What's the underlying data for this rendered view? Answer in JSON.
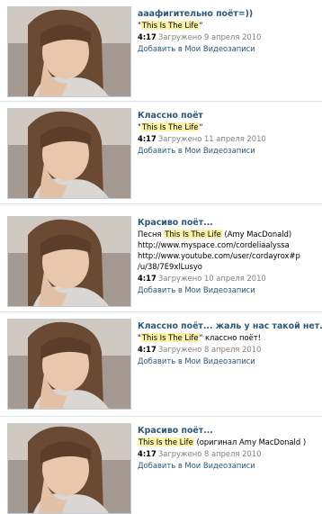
{
  "videos": [
    {
      "title": "ааафигительно поёт=))",
      "desc_before": "\"",
      "desc_highlight": "This Is The Life",
      "desc_after": "\"",
      "duration": "4:17",
      "uploaded": "Загружено 9 апреля 2010",
      "add_label": "Добавить в Мои Видеозаписи"
    },
    {
      "title": "Классно поёт",
      "desc_before": "\"",
      "desc_highlight": "This Is The Life",
      "desc_after": "\"",
      "duration": "4:17",
      "uploaded": "Загружено 11 апреля 2010",
      "add_label": "Добавить в Мои Видеозаписи"
    },
    {
      "title": "Красиво поёт...",
      "desc_before": "Песня ",
      "desc_highlight": "This Is The Life",
      "desc_after": " (Amy MacDonald)",
      "desc_lines": [
        "http://www.myspace.com/cordeliaalyssa",
        "http://www.youtube.com/user/cordayrox#p",
        "/u/38/7E9xlLusyo"
      ],
      "duration": "4:17",
      "uploaded": "Загружено 10 апреля 2010",
      "add_label": "Добавить в Мои Видеозаписи"
    },
    {
      "title": "Классно поёт... жаль у нас такой нет..",
      "desc_before": "\"",
      "desc_highlight": "This Is The Life",
      "desc_after": "\" классно поёт!",
      "duration": "4:17",
      "uploaded": "Загружено 8 апреля 2010",
      "add_label": "Добавить в Мои Видеозаписи"
    },
    {
      "title": "Красиво поёт...",
      "desc_before": "",
      "desc_highlight": "This Is the Life",
      "desc_after": " (оригинал Amy MacDonald )",
      "duration": "4:17",
      "uploaded": "Загружено 8 апреля 2010",
      "add_label": "Добавить в Мои Видеозаписи"
    }
  ]
}
